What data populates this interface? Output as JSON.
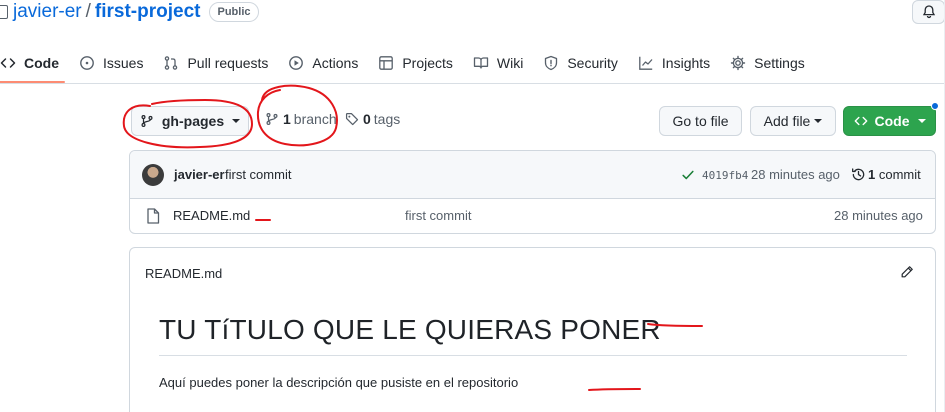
{
  "repo": {
    "owner": "javier-er",
    "separator": "/",
    "name": "first-project",
    "visibility": "Public"
  },
  "tabs": [
    {
      "label": "Code",
      "icon": "code-icon",
      "selected": true
    },
    {
      "label": "Issues",
      "icon": "issue-opened-icon"
    },
    {
      "label": "Pull requests",
      "icon": "git-pull-request-icon"
    },
    {
      "label": "Actions",
      "icon": "play-icon"
    },
    {
      "label": "Projects",
      "icon": "table-icon"
    },
    {
      "label": "Wiki",
      "icon": "book-icon"
    },
    {
      "label": "Security",
      "icon": "shield-icon"
    },
    {
      "label": "Insights",
      "icon": "graph-icon"
    },
    {
      "label": "Settings",
      "icon": "gear-icon"
    }
  ],
  "branch_bar": {
    "current_branch": "gh-pages",
    "branch_count": "1",
    "branch_label": "branch",
    "tag_count": "0",
    "tag_label": "tags",
    "goto_file_label": "Go to file",
    "add_file_label": "Add file",
    "code_label": "Code"
  },
  "latest_commit": {
    "author": "javier-er",
    "message": "first commit",
    "sha": "4019fb4",
    "time": "28 minutes ago",
    "count": "1",
    "count_label": "commit"
  },
  "files": [
    {
      "name": "README.md",
      "commit_message": "first commit",
      "time": "28 minutes ago"
    }
  ],
  "readme": {
    "filename": "README.md",
    "heading": "TU TíTULO QUE LE QUIERAS PONER",
    "paragraph": "Aquí puedes poner la descripción que pusiste en el repositorio"
  },
  "colors": {
    "accent_link": "#0969da",
    "primary_button": "#2da44e",
    "selected_tab_underline": "#fd8c73",
    "annotation": "#e3161b"
  }
}
